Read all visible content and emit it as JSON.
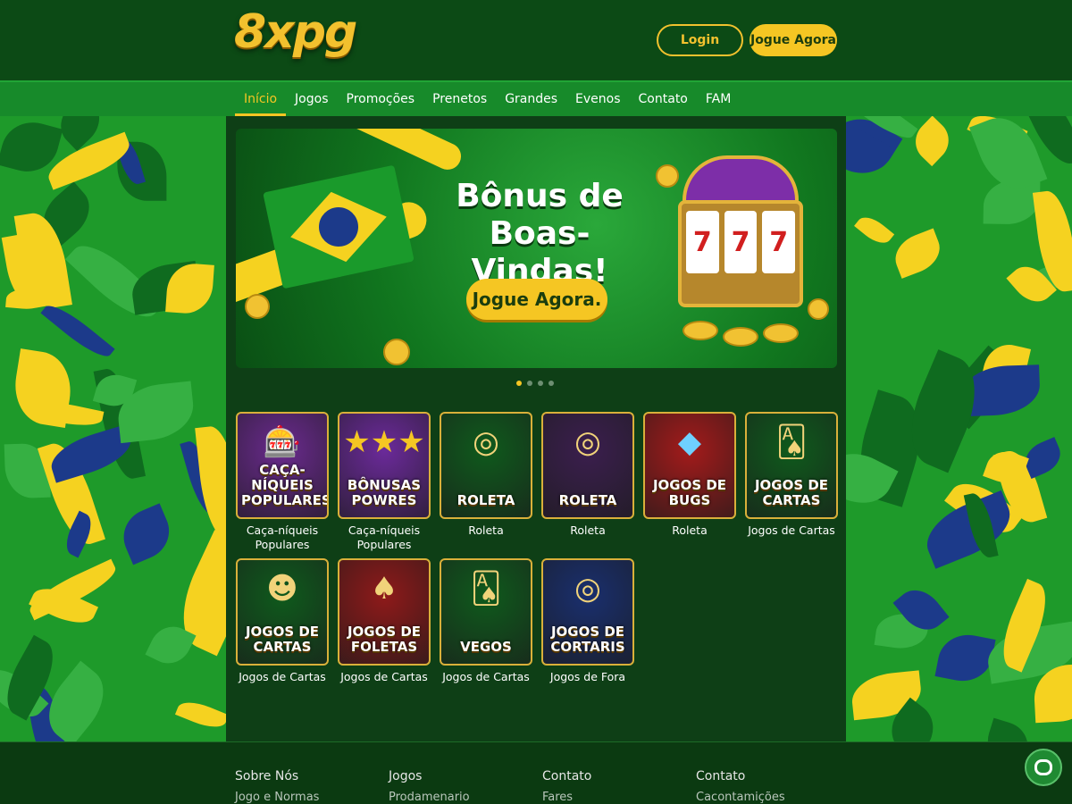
{
  "brand": {
    "logo": "8xpg"
  },
  "header": {
    "login_label": "Login",
    "play_label": "Jogue Agora"
  },
  "nav": {
    "items": [
      "Início",
      "Jogos",
      "Promoções",
      "Prenetos",
      "Grandes",
      "Evenos",
      "Contato",
      "FAM"
    ],
    "active_index": 0
  },
  "banner": {
    "title_line1": "Bônus de",
    "title_line2": "Boas-Vindas!",
    "cta_label": "Jogue Agora.",
    "slot_symbol": "7",
    "slides_count": 4,
    "active_slide": 0
  },
  "games": [
    {
      "thumb_title": "CAÇA-NÍQUEIS POPULARES",
      "icon": "slot-machine-icon",
      "caption": "Caça-níqueis Populares"
    },
    {
      "thumb_title": "BÔNUSAS POWRES",
      "icon": "stars-icon",
      "caption": "Caça-níqueis Populares"
    },
    {
      "thumb_title": "ROLETA",
      "icon": "roulette-icon",
      "caption": "Roleta"
    },
    {
      "thumb_title": "ROLETA",
      "icon": "roulette-icon",
      "caption": "Roleta"
    },
    {
      "thumb_title": "JOGOS DE BUGS",
      "icon": "diamond-icon",
      "caption": "Roleta"
    },
    {
      "thumb_title": "JOGOS DE CARTAS",
      "icon": "cards-icon",
      "caption": "Jogos de Cartas"
    },
    {
      "thumb_title": "JOGOS DE CARTAS",
      "icon": "mascot-icon",
      "caption": "Jogos de Cartas"
    },
    {
      "thumb_title": "JOGOS DE FOLETAS",
      "icon": "spade-icon",
      "caption": "Jogos de Cartas"
    },
    {
      "thumb_title": "VEGOS",
      "icon": "cards-icon",
      "caption": "Jogos de Cartas"
    },
    {
      "thumb_title": "JOGOS DE CORTARIS",
      "icon": "roulette-icon",
      "caption": "Jogos de Fora"
    }
  ],
  "footer": {
    "columns": [
      {
        "title": "Sobre Nós",
        "sub": "Jogo e Normas"
      },
      {
        "title": "Jogos",
        "sub": "Prodamenario"
      },
      {
        "title": "Contato",
        "sub": "Fares"
      },
      {
        "title": "Contato",
        "sub": "Cacontamições"
      }
    ]
  },
  "colors": {
    "gold": "#f5c623",
    "green_dark": "#0c4a15",
    "green_nav": "#178a2a",
    "blue": "#1c3a8a"
  }
}
